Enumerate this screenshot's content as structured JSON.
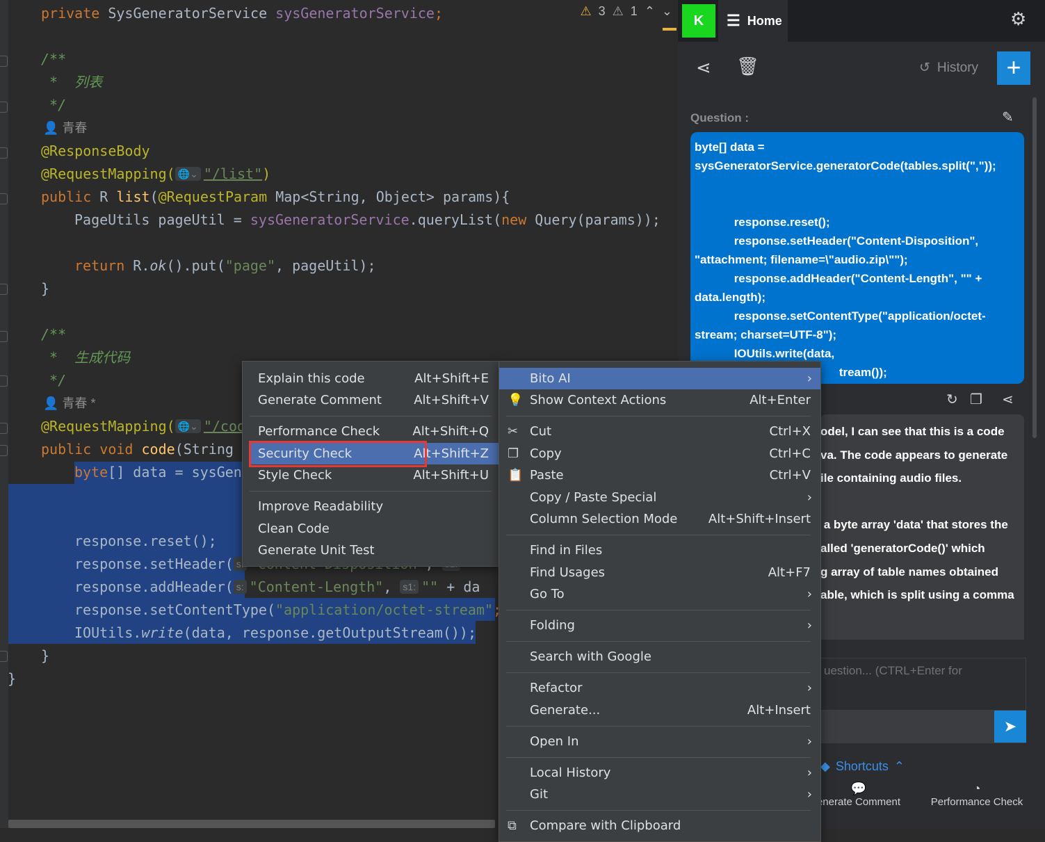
{
  "editor": {
    "warnings": {
      "warn_count": "3",
      "weak_warn_count": "1"
    },
    "lines": {
      "l1": {
        "kw": "private",
        "type": "SysGeneratorService",
        "field": "sysGeneratorService",
        "semi": ";"
      },
      "l2": "/**",
      "l3": " *  列表",
      "l4": " */",
      "l5_author": "青春",
      "l6": "@ResponseBody",
      "l7": {
        "ann": "@RequestMapping(",
        "path": "\"/list\"",
        "close": ")"
      },
      "l8": {
        "kw": "public",
        "type": "R",
        "fn": "list",
        "ann": "@RequestParam",
        "rest": " Map<String, Object> params){"
      },
      "l9": {
        "a": "PageUtils pageUtil = ",
        "field": "sysGeneratorService",
        "b": ".queryList(",
        "kw": "new",
        "c": " Query(params));"
      },
      "l10": {
        "kw": "return",
        "a": " R.",
        "it": "ok",
        "b": "().put(",
        "str": "\"page\"",
        "c": ", pageUtil);"
      },
      "l11": "}",
      "l12": "/**",
      "l13": " *  生成代码",
      "l14": " */",
      "l15_author": "青春 *",
      "l16": {
        "ann": "@RequestMapping(",
        "path": "\"/code"
      },
      "l17": {
        "kw": "public",
        "kw2": "void",
        "fn": "code",
        "rest": "(String"
      },
      "l18": {
        "kw": "byte",
        "a": "[] data = sysGen"
      },
      "l19": "response.reset();",
      "l20": {
        "a": "response.setHeader(",
        "hint": "s:",
        "str": "\"Content-Disposition\"",
        "b": ", ",
        "hint2": "s1:",
        "c": "\""
      },
      "l21": {
        "a": "response.addHeader(",
        "hint": "s:",
        "str": "\"Content-Length\"",
        "b": ", ",
        "hint2": "s1:",
        "str2": "\"\"",
        "c": " + da"
      },
      "l22": {
        "a": "response.setContentType(",
        "str": "\"application/octet-stream\"",
        "c": ";"
      },
      "l23": {
        "a": "IOUtils.",
        "it": "write",
        "b": "(data, response.getOutputStream());"
      },
      "l24": "}",
      "l25": "}"
    }
  },
  "bito": {
    "avatar_letter": "K",
    "home_tab": "Home",
    "history_label": "History",
    "question_label": "Question :",
    "question_text": "byte[] data =\nsysGeneratorService.generatorCode(tables.split(\",\"));\n\n\n            response.reset();\n            response.setHeader(\"Content-Disposition\",\n\"attachment; filename=\\\"audio.zip\\\"\");\n            response.addHeader(\"Content-Length\", \"\" +\ndata.length);\n            response.setContentType(\"application/octet-\nstream; charset=UTF-8\");\n            IOUtils.write(data,\n                                            tream());",
    "answer_text": "odel, I can see that this is a code\nva. The code appears to generate\nile containing audio files.\n\n a byte array 'data' that stores the\nalled 'generatorCode()' which\ng array of table names obtained\nable, which is split using a comma",
    "input_placeholder": "uestion... (CTRL+Enter for",
    "shortcuts_label": "Shortcuts",
    "shortcut_items": [
      "enerate Comment",
      "Performance Check"
    ]
  },
  "submenu": [
    {
      "label": "Explain this code",
      "shortcut": "Alt+Shift+E"
    },
    {
      "label": "Generate Comment",
      "shortcut": "Alt+Shift+V"
    },
    {
      "label": "Performance Check",
      "shortcut": "Alt+Shift+Q"
    },
    {
      "label": "Security Check",
      "shortcut": "Alt+Shift+Z"
    },
    {
      "label": "Style Check",
      "shortcut": "Alt+Shift+U"
    },
    {
      "label": "Improve Readability",
      "shortcut": ""
    },
    {
      "label": "Clean Code",
      "shortcut": ""
    },
    {
      "label": "Generate Unit Test",
      "shortcut": ""
    }
  ],
  "context_menu": [
    {
      "label": "Bito AI",
      "shortcut": ""
    },
    {
      "label": "Show Context Actions",
      "shortcut": "Alt+Enter"
    },
    {
      "label": "Cut",
      "shortcut": "Ctrl+X"
    },
    {
      "label": "Copy",
      "shortcut": "Ctrl+C"
    },
    {
      "label": "Paste",
      "shortcut": "Ctrl+V"
    },
    {
      "label": "Copy / Paste Special",
      "shortcut": ""
    },
    {
      "label": "Column Selection Mode",
      "shortcut": "Alt+Shift+Insert"
    },
    {
      "label": "Find in Files",
      "shortcut": ""
    },
    {
      "label": "Find Usages",
      "shortcut": "Alt+F7"
    },
    {
      "label": "Go To",
      "shortcut": ""
    },
    {
      "label": "Folding",
      "shortcut": ""
    },
    {
      "label": "Search with Google",
      "shortcut": ""
    },
    {
      "label": "Refactor",
      "shortcut": ""
    },
    {
      "label": "Generate...",
      "shortcut": "Alt+Insert"
    },
    {
      "label": "Open In",
      "shortcut": ""
    },
    {
      "label": "Local History",
      "shortcut": ""
    },
    {
      "label": "Git",
      "shortcut": ""
    },
    {
      "label": "Compare with Clipboard",
      "shortcut": ""
    }
  ],
  "colors": {
    "selection": "#214283",
    "menu_active": "#4b6eaf",
    "accent": "#1a86d6",
    "avatar": "#19d61f",
    "highlight_border": "#e53935"
  }
}
